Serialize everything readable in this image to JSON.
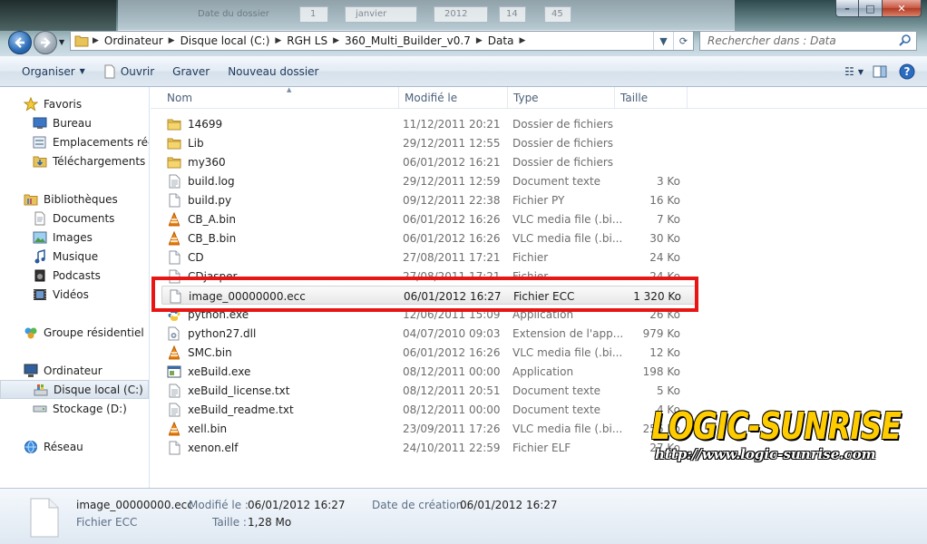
{
  "window": {
    "controls": {
      "minimize": "–",
      "maximize": "□",
      "close": "✕"
    }
  },
  "background_dialog": {
    "label": "Date du dossier",
    "fields": [
      "1",
      "janvier",
      "2012",
      "14",
      "45"
    ]
  },
  "nav": {
    "breadcrumb": [
      "Ordinateur",
      "Disque local (C:)",
      "RGH LS",
      "360_Multi_Builder_v0.7",
      "Data"
    ],
    "search_placeholder": "Rechercher dans : Data"
  },
  "toolbar": {
    "organize": "Organiser",
    "open": "Ouvrir",
    "burn": "Graver",
    "new_folder": "Nouveau dossier"
  },
  "sidebar": {
    "favorites": "Favoris",
    "favorites_items": [
      "Bureau",
      "Emplacements récen",
      "Téléchargements"
    ],
    "libraries": "Bibliothèques",
    "libraries_items": [
      "Documents",
      "Images",
      "Musique",
      "Podcasts",
      "Vidéos"
    ],
    "homegroup": "Groupe résidentiel",
    "computer": "Ordinateur",
    "computer_items": [
      "Disque local (C:)",
      "Stockage (D:)"
    ],
    "network": "Réseau"
  },
  "columns": {
    "name": "Nom",
    "modified": "Modifié le",
    "type": "Type",
    "size": "Taille"
  },
  "files": [
    {
      "name": "14699",
      "date": "11/12/2011 20:21",
      "type": "Dossier de fichiers",
      "size": "",
      "icon": "folder-icon"
    },
    {
      "name": "Lib",
      "date": "29/12/2011 12:55",
      "type": "Dossier de fichiers",
      "size": "",
      "icon": "folder-icon"
    },
    {
      "name": "my360",
      "date": "06/01/2012 16:21",
      "type": "Dossier de fichiers",
      "size": "",
      "icon": "folder-icon"
    },
    {
      "name": "build.log",
      "date": "29/12/2011 12:59",
      "type": "Document texte",
      "size": "3 Ko",
      "icon": "text-file-icon"
    },
    {
      "name": "build.py",
      "date": "09/12/2011 22:38",
      "type": "Fichier PY",
      "size": "16 Ko",
      "icon": "file-icon"
    },
    {
      "name": "CB_A.bin",
      "date": "06/01/2012 16:26",
      "type": "VLC media file (.bi...",
      "size": "7 Ko",
      "icon": "vlc-icon"
    },
    {
      "name": "CB_B.bin",
      "date": "06/01/2012 16:26",
      "type": "VLC media file (.bi...",
      "size": "30 Ko",
      "icon": "vlc-icon"
    },
    {
      "name": "CD",
      "date": "27/08/2011 17:21",
      "type": "Fichier",
      "size": "24 Ko",
      "icon": "file-icon"
    },
    {
      "name": "CDjasper",
      "date": "27/08/2011 17:21",
      "type": "Fichier",
      "size": "24 Ko",
      "icon": "file-icon"
    },
    {
      "name": "image_00000000.ecc",
      "date": "06/01/2012 16:27",
      "type": "Fichier ECC",
      "size": "1 320 Ko",
      "icon": "file-icon"
    },
    {
      "name": "python.exe",
      "date": "12/06/2011 15:09",
      "type": "Application",
      "size": "26 Ko",
      "icon": "python-icon"
    },
    {
      "name": "python27.dll",
      "date": "04/07/2010 09:03",
      "type": "Extension de l'app...",
      "size": "979 Ko",
      "icon": "dll-icon"
    },
    {
      "name": "SMC.bin",
      "date": "06/01/2012 16:26",
      "type": "VLC media file (.bi...",
      "size": "12 Ko",
      "icon": "vlc-icon"
    },
    {
      "name": "xeBuild.exe",
      "date": "08/12/2011 00:00",
      "type": "Application",
      "size": "198 Ko",
      "icon": "exe-icon"
    },
    {
      "name": "xeBuild_license.txt",
      "date": "08/12/2011 20:51",
      "type": "Document texte",
      "size": "5 Ko",
      "icon": "text-file-icon"
    },
    {
      "name": "xeBuild_readme.txt",
      "date": "08/12/2011 00:00",
      "type": "Document texte",
      "size": "4 Ko",
      "icon": "text-file-icon"
    },
    {
      "name": "xell.bin",
      "date": "23/09/2011 17:26",
      "type": "VLC media file (.bi...",
      "size": "256 Ko",
      "icon": "vlc-icon"
    },
    {
      "name": "xenon.elf",
      "date": "24/10/2011 22:59",
      "type": "Fichier ELF",
      "size": "27 Ko",
      "icon": "file-icon"
    }
  ],
  "selected_index": 9,
  "watermark": {
    "logo": "LOGIC-SUNRISE",
    "url": "http://www.logic-sunrise.com"
  },
  "details": {
    "filename": "image_00000000.ecc",
    "filetype": "Fichier ECC",
    "modified_label": "Modifié le :",
    "modified_value": "06/01/2012 16:27",
    "created_label": "Date de création :",
    "created_value": "06/01/2012 16:27",
    "size_label": "Taille :",
    "size_value": "1,28 Mo"
  },
  "colors": {
    "highlight": "#e81515",
    "watermark_logo": "#ffcc00"
  }
}
